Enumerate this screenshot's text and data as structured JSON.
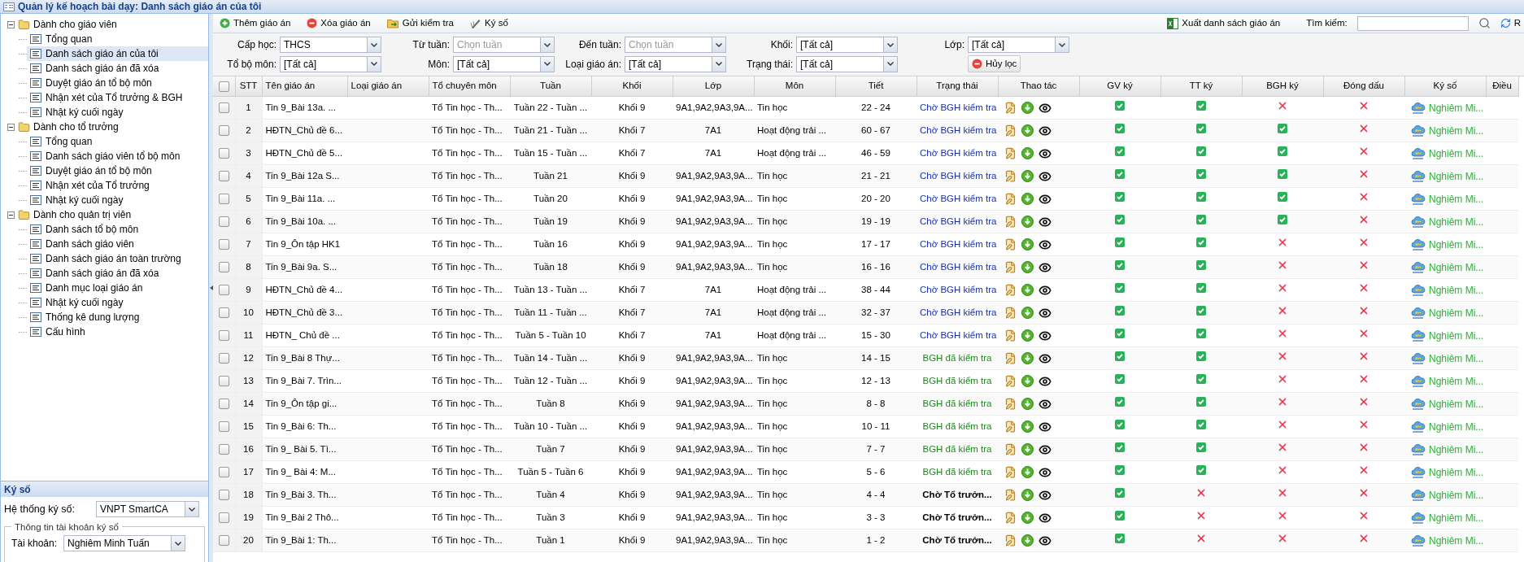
{
  "window": {
    "title": "Quản lý kế hoạch bài dạy: Danh sách giáo án của tôi"
  },
  "sidebar": {
    "groups": [
      {
        "label": "Dành cho giáo viên",
        "expanded": true,
        "children": [
          {
            "label": "Tổng quan",
            "selected": false
          },
          {
            "label": "Danh sách giáo án của tôi",
            "selected": true
          },
          {
            "label": "Danh sách giáo án đã xóa",
            "selected": false
          },
          {
            "label": "Duyệt giáo án tổ bộ môn",
            "selected": false
          },
          {
            "label": "Nhận xét của Tổ trưởng & BGH",
            "selected": false
          },
          {
            "label": "Nhật ký cuối ngày",
            "selected": false
          }
        ]
      },
      {
        "label": "Dành cho tổ trưởng",
        "expanded": true,
        "children": [
          {
            "label": "Tổng quan",
            "selected": false
          },
          {
            "label": "Danh sách giáo viên tổ bộ môn",
            "selected": false
          },
          {
            "label": "Duyệt giáo án tổ bộ môn",
            "selected": false
          },
          {
            "label": "Nhận xét của Tổ trưởng",
            "selected": false
          },
          {
            "label": "Nhật ký cuối ngày",
            "selected": false
          }
        ]
      },
      {
        "label": "Dành cho quản trị viên",
        "expanded": true,
        "children": [
          {
            "label": "Danh sách tổ bộ môn",
            "selected": false
          },
          {
            "label": "Danh sách giáo viên",
            "selected": false
          },
          {
            "label": "Danh sách giáo án toàn trường",
            "selected": false
          },
          {
            "label": "Danh sách giáo án đã xóa",
            "selected": false
          },
          {
            "label": "Danh mục loại giáo án",
            "selected": false
          },
          {
            "label": "Nhật ký cuối ngày",
            "selected": false
          },
          {
            "label": "Thống kê dung lượng",
            "selected": false
          },
          {
            "label": "Cấu hình",
            "selected": false
          }
        ]
      }
    ]
  },
  "sign_panel": {
    "title": "Ký số",
    "system_label": "Hệ thống ký số:",
    "system_value": "VNPT SmartCA",
    "account_legend": "Thông tin tài khoản ký số",
    "account_label": "Tài khoản:",
    "account_value": "Nghiêm Minh Tuấn"
  },
  "toolbar": {
    "buttons": [
      {
        "label": "Thêm giáo án",
        "kind": "add"
      },
      {
        "label": "Xóa giáo án",
        "kind": "delete"
      },
      {
        "label": "Gửi kiểm tra",
        "kind": "send"
      },
      {
        "label": "Ký số",
        "kind": "sign"
      }
    ],
    "export": "Xuất danh sách giáo án",
    "search_label": "Tìm kiếm:",
    "refresh": "R"
  },
  "filters": [
    [
      {
        "label": "Cấp học:",
        "value": "THCS"
      },
      {
        "label": "Từ tuần:",
        "placeholder": "Chọn tuần"
      },
      {
        "label": "Đến tuần:",
        "placeholder": "Chọn tuần"
      },
      {
        "label": "Khối:",
        "value": "[Tất cả]"
      },
      {
        "label": "Lớp:",
        "value": "[Tất cả]"
      }
    ],
    [
      {
        "label": "Tổ bộ môn:",
        "value": "[Tất cả]"
      },
      {
        "label": "Môn:",
        "value": "[Tất cả]"
      },
      {
        "label": "Loại giáo án:",
        "value": "[Tất cả]"
      },
      {
        "label": "Trạng thái:",
        "value": "[Tất cả]"
      }
    ]
  ],
  "clear_filter": "Hủy lọc",
  "table": {
    "select_all": false,
    "columns": [
      "STT",
      "Tên giáo án",
      "Loại giáo án",
      "Tổ chuyên môn",
      "Tuần",
      "Khối",
      "Lớp",
      "Môn",
      "Tiết",
      "Trạng thái",
      "Thao tác",
      "GV ký",
      "TT ký",
      "BGH ký",
      "Đóng dấu",
      "Ký số",
      "Điều"
    ],
    "rows": [
      {
        "selected": false,
        "stt": "1",
        "name": "Tin 9_Bài 13a. ...",
        "group": "Tổ Tin học - Th...",
        "week": "Tuần 22 - Tuần ...",
        "grade": "Khối 9",
        "class": "9A1,9A2,9A3,9A...",
        "subject": "Tin học",
        "periods": "22 - 24",
        "status": {
          "text": "Chờ BGH kiểm tra",
          "kind": "pending_bgh"
        },
        "gv_signed": true,
        "tt_signed": true,
        "bgh_signed": false,
        "stamped": false,
        "signer": "Nghiêm Mi..."
      },
      {
        "selected": false,
        "stt": "2",
        "name": "HĐTN_Chủ đề 6...",
        "group": "Tổ Tin học - Th...",
        "week": "Tuần 21 - Tuần ...",
        "grade": "Khối 7",
        "class": "7A1",
        "subject": "Hoạt động trải ...",
        "periods": "60 - 67",
        "status": {
          "text": "Chờ BGH kiểm tra",
          "kind": "pending_bgh"
        },
        "gv_signed": true,
        "tt_signed": true,
        "bgh_signed": true,
        "stamped": false,
        "signer": "Nghiêm Mi..."
      },
      {
        "selected": false,
        "stt": "3",
        "name": "HĐTN_Chủ đề 5...",
        "group": "Tổ Tin học - Th...",
        "week": "Tuần 15 - Tuần ...",
        "grade": "Khối 7",
        "class": "7A1",
        "subject": "Hoạt động trải ...",
        "periods": "46 - 59",
        "status": {
          "text": "Chờ BGH kiểm tra",
          "kind": "pending_bgh"
        },
        "gv_signed": true,
        "tt_signed": true,
        "bgh_signed": true,
        "stamped": false,
        "signer": "Nghiêm Mi..."
      },
      {
        "selected": false,
        "stt": "4",
        "name": "Tin 9_Bài 12a S...",
        "group": "Tổ Tin học - Th...",
        "week": "Tuần 21",
        "grade": "Khối 9",
        "class": "9A1,9A2,9A3,9A...",
        "subject": "Tin học",
        "periods": "21 - 21",
        "status": {
          "text": "Chờ BGH kiểm tra",
          "kind": "pending_bgh"
        },
        "gv_signed": true,
        "tt_signed": true,
        "bgh_signed": true,
        "stamped": false,
        "signer": "Nghiêm Mi..."
      },
      {
        "selected": false,
        "stt": "5",
        "name": "Tin 9_Bài 11a. ...",
        "group": "Tổ Tin học - Th...",
        "week": "Tuần 20",
        "grade": "Khối 9",
        "class": "9A1,9A2,9A3,9A...",
        "subject": "Tin học",
        "periods": "20 - 20",
        "status": {
          "text": "Chờ BGH kiểm tra",
          "kind": "pending_bgh"
        },
        "gv_signed": true,
        "tt_signed": true,
        "bgh_signed": true,
        "stamped": false,
        "signer": "Nghiêm Mi..."
      },
      {
        "selected": false,
        "stt": "6",
        "name": "Tin 9_Bài 10a. ...",
        "group": "Tổ Tin học - Th...",
        "week": "Tuần 19",
        "grade": "Khối 9",
        "class": "9A1,9A2,9A3,9A...",
        "subject": "Tin học",
        "periods": "19 - 19",
        "status": {
          "text": "Chờ BGH kiểm tra",
          "kind": "pending_bgh"
        },
        "gv_signed": true,
        "tt_signed": true,
        "bgh_signed": true,
        "stamped": false,
        "signer": "Nghiêm Mi..."
      },
      {
        "selected": false,
        "stt": "7",
        "name": "Tin 9_Ôn tập HK1",
        "group": "Tổ Tin học - Th...",
        "week": "Tuần 16",
        "grade": "Khối 9",
        "class": "9A1,9A2,9A3,9A...",
        "subject": "Tin học",
        "periods": "17 - 17",
        "status": {
          "text": "Chờ BGH kiểm tra",
          "kind": "pending_bgh"
        },
        "gv_signed": true,
        "tt_signed": true,
        "bgh_signed": false,
        "stamped": false,
        "signer": "Nghiêm Mi..."
      },
      {
        "selected": false,
        "stt": "8",
        "name": "Tin 9_Bài 9a. S...",
        "group": "Tổ Tin học - Th...",
        "week": "Tuần 18",
        "grade": "Khối 9",
        "class": "9A1,9A2,9A3,9A...",
        "subject": "Tin học",
        "periods": "16 - 16",
        "status": {
          "text": "Chờ BGH kiểm tra",
          "kind": "pending_bgh"
        },
        "gv_signed": true,
        "tt_signed": true,
        "bgh_signed": false,
        "stamped": false,
        "signer": "Nghiêm Mi..."
      },
      {
        "selected": false,
        "stt": "9",
        "name": "HĐTN_Chủ đề 4...",
        "group": "Tổ Tin học - Th...",
        "week": "Tuần 13 - Tuần ...",
        "grade": "Khối 7",
        "class": "7A1",
        "subject": "Hoạt động trải ...",
        "periods": "38 - 44",
        "status": {
          "text": "Chờ BGH kiểm tra",
          "kind": "pending_bgh"
        },
        "gv_signed": true,
        "tt_signed": true,
        "bgh_signed": false,
        "stamped": false,
        "signer": "Nghiêm Mi..."
      },
      {
        "selected": false,
        "stt": "10",
        "name": "HĐTN_Chủ đề 3...",
        "group": "Tổ Tin học - Th...",
        "week": "Tuần 11 - Tuần ...",
        "grade": "Khối 7",
        "class": "7A1",
        "subject": "Hoạt động trải ...",
        "periods": "32 - 37",
        "status": {
          "text": "Chờ BGH kiểm tra",
          "kind": "pending_bgh"
        },
        "gv_signed": true,
        "tt_signed": true,
        "bgh_signed": false,
        "stamped": false,
        "signer": "Nghiêm Mi..."
      },
      {
        "selected": false,
        "stt": "11",
        "name": "HĐTN_ Chủ đề ...",
        "group": "Tổ Tin học - Th...",
        "week": "Tuần 5 - Tuần 10",
        "grade": "Khối 7",
        "class": "7A1",
        "subject": "Hoạt động trải ...",
        "periods": "15 - 30",
        "status": {
          "text": "Chờ BGH kiểm tra",
          "kind": "pending_bgh"
        },
        "gv_signed": true,
        "tt_signed": true,
        "bgh_signed": false,
        "stamped": false,
        "signer": "Nghiêm Mi..."
      },
      {
        "selected": false,
        "stt": "12",
        "name": "Tin 9_Bài 8 Thự...",
        "group": "Tổ Tin học - Th...",
        "week": "Tuần 14 - Tuần ...",
        "grade": "Khối 9",
        "class": "9A1,9A2,9A3,9A...",
        "subject": "Tin học",
        "periods": "14 - 15",
        "status": {
          "text": "BGH đã kiểm tra",
          "kind": "checked_bgh"
        },
        "gv_signed": true,
        "tt_signed": true,
        "bgh_signed": false,
        "stamped": false,
        "signer": "Nghiêm Mi..."
      },
      {
        "selected": false,
        "stt": "13",
        "name": "Tin 9_Bài 7. Trìn...",
        "group": "Tổ Tin học - Th...",
        "week": "Tuần 12 - Tuần ...",
        "grade": "Khối 9",
        "class": "9A1,9A2,9A3,9A...",
        "subject": "Tin học",
        "periods": "12 - 13",
        "status": {
          "text": "BGH đã kiểm tra",
          "kind": "checked_bgh"
        },
        "gv_signed": true,
        "tt_signed": true,
        "bgh_signed": false,
        "stamped": false,
        "signer": "Nghiêm Mi..."
      },
      {
        "selected": false,
        "stt": "14",
        "name": "Tin 9_Ôn tập gi...",
        "group": "Tổ Tin học - Th...",
        "week": "Tuần 8",
        "grade": "Khối 9",
        "class": "9A1,9A2,9A3,9A...",
        "subject": "Tin học",
        "periods": "8 - 8",
        "status": {
          "text": "BGH đã kiểm tra",
          "kind": "checked_bgh"
        },
        "gv_signed": true,
        "tt_signed": true,
        "bgh_signed": false,
        "stamped": false,
        "signer": "Nghiêm Mi..."
      },
      {
        "selected": false,
        "stt": "15",
        "name": "Tin 9_Bài 6: Th...",
        "group": "Tổ Tin học - Th...",
        "week": "Tuần 10 - Tuần ...",
        "grade": "Khối 9",
        "class": "9A1,9A2,9A3,9A...",
        "subject": "Tin học",
        "periods": "10 - 11",
        "status": {
          "text": "BGH đã kiểm tra",
          "kind": "checked_bgh"
        },
        "gv_signed": true,
        "tt_signed": true,
        "bgh_signed": false,
        "stamped": false,
        "signer": "Nghiêm Mi..."
      },
      {
        "selected": false,
        "stt": "16",
        "name": "Tin 9_ Bài 5. Tì...",
        "group": "Tổ Tin học - Th...",
        "week": "Tuần 7",
        "grade": "Khối 9",
        "class": "9A1,9A2,9A3,9A...",
        "subject": "Tin học",
        "periods": "7 - 7",
        "status": {
          "text": "BGH đã kiểm tra",
          "kind": "checked_bgh"
        },
        "gv_signed": true,
        "tt_signed": true,
        "bgh_signed": false,
        "stamped": false,
        "signer": "Nghiêm Mi..."
      },
      {
        "selected": false,
        "stt": "17",
        "name": "Tin 9_ Bài 4: M...",
        "group": "Tổ Tin học - Th...",
        "week": "Tuần 5 - Tuần 6",
        "grade": "Khối 9",
        "class": "9A1,9A2,9A3,9A...",
        "subject": "Tin học",
        "periods": "5 - 6",
        "status": {
          "text": "BGH đã kiểm tra",
          "kind": "checked_bgh"
        },
        "gv_signed": true,
        "tt_signed": true,
        "bgh_signed": false,
        "stamped": false,
        "signer": "Nghiêm Mi..."
      },
      {
        "selected": false,
        "stt": "18",
        "name": "Tin 9_Bài 3. Th...",
        "group": "Tổ Tin học - Th...",
        "week": "Tuần 4",
        "grade": "Khối 9",
        "class": "9A1,9A2,9A3,9A...",
        "subject": "Tin học",
        "periods": "4 - 4",
        "status": {
          "text": "Chờ Tổ trưởn...",
          "kind": "pending_tt"
        },
        "gv_signed": true,
        "tt_signed": false,
        "bgh_signed": false,
        "stamped": false,
        "signer": "Nghiêm Mi..."
      },
      {
        "selected": false,
        "stt": "19",
        "name": "Tin 9_Bài 2 Thô...",
        "group": "Tổ Tin học - Th...",
        "week": "Tuần 3",
        "grade": "Khối 9",
        "class": "9A1,9A2,9A3,9A...",
        "subject": "Tin học",
        "periods": "3 - 3",
        "status": {
          "text": "Chờ Tổ trưởn...",
          "kind": "pending_tt"
        },
        "gv_signed": true,
        "tt_signed": false,
        "bgh_signed": false,
        "stamped": false,
        "signer": "Nghiêm Mi..."
      },
      {
        "selected": false,
        "stt": "20",
        "name": "Tin 9_Bài 1: Th...",
        "group": "Tổ Tin học - Th...",
        "week": "Tuần 1",
        "grade": "Khối 9",
        "class": "9A1,9A2,9A3,9A...",
        "subject": "Tin học",
        "periods": "1 - 2",
        "status": {
          "text": "Chờ Tổ trưởn...",
          "kind": "pending_tt"
        },
        "gv_signed": true,
        "tt_signed": false,
        "bgh_signed": false,
        "stamped": false,
        "signer": "Nghiêm Mi..."
      }
    ]
  }
}
